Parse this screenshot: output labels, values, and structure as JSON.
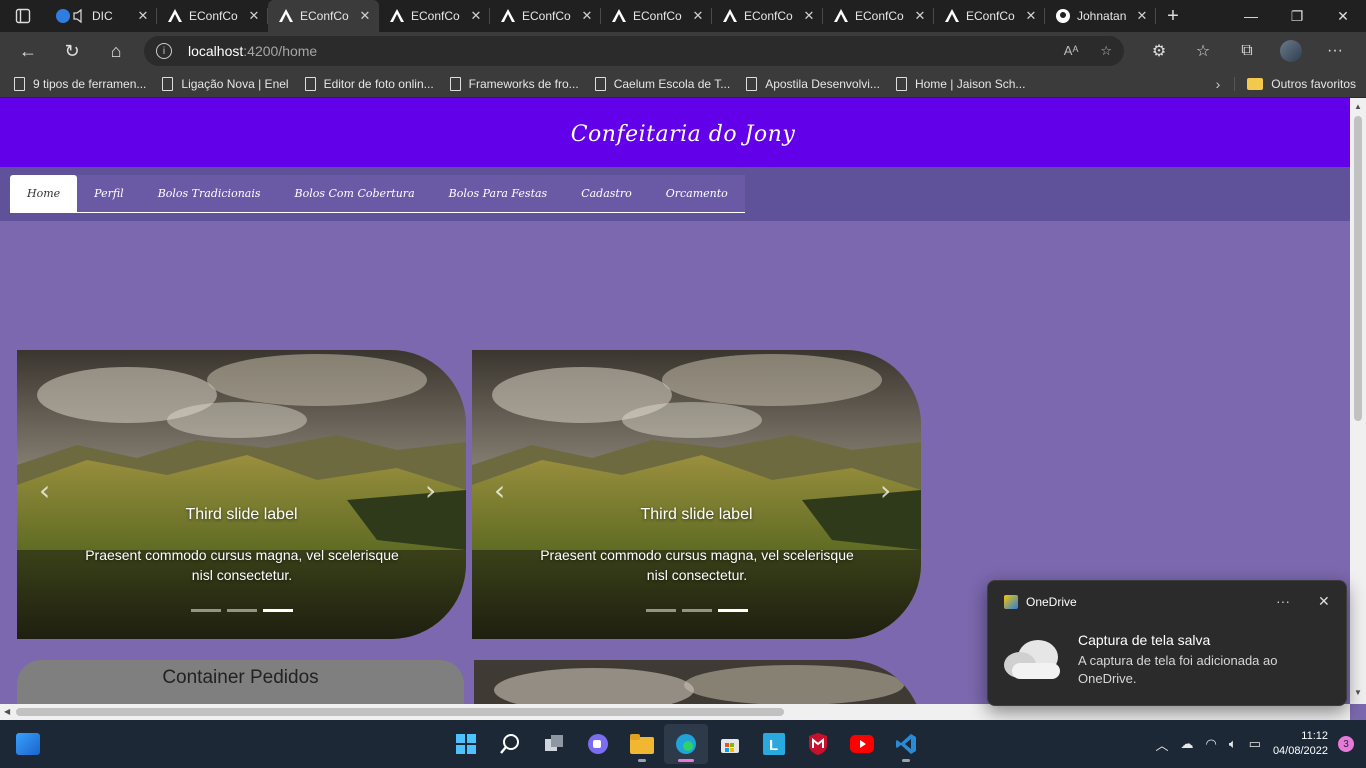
{
  "browser": {
    "tabs": [
      {
        "title": "DIC",
        "favicon": "speaker-icon",
        "active": false
      },
      {
        "title": "EConfCo",
        "favicon": "angular-icon",
        "active": false
      },
      {
        "title": "EConfCo",
        "favicon": "angular-icon",
        "active": true
      },
      {
        "title": "EConfCo",
        "favicon": "angular-icon",
        "active": false
      },
      {
        "title": "EConfCo",
        "favicon": "angular-icon",
        "active": false
      },
      {
        "title": "EConfCo",
        "favicon": "angular-icon",
        "active": false
      },
      {
        "title": "EConfCo",
        "favicon": "angular-icon",
        "active": false
      },
      {
        "title": "EConfCo",
        "favicon": "angular-icon",
        "active": false
      },
      {
        "title": "EConfCo",
        "favicon": "angular-icon",
        "active": false
      },
      {
        "title": "Johnatan",
        "favicon": "github-icon",
        "active": false
      }
    ],
    "address": {
      "host": "localhost",
      "path": ":4200/home"
    },
    "bookmarks": [
      "9 tipos de ferramen...",
      "Ligação Nova | Enel",
      "Editor de foto onlin...",
      "Frameworks de fro...",
      "Caelum Escola de T...",
      "Apostila Desenvolvi...",
      "Home | Jaison Sch..."
    ],
    "other_favorites": "Outros favoritos"
  },
  "site": {
    "title": "Confeitaria do Jony",
    "nav": [
      {
        "label": "Home",
        "active": true
      },
      {
        "label": "Perfil",
        "active": false
      },
      {
        "label": "Bolos Tradicionais",
        "active": false
      },
      {
        "label": "Bolos Com Cobertura",
        "active": false
      },
      {
        "label": "Bolos Para Festas",
        "active": false
      },
      {
        "label": "Cadastro",
        "active": false
      },
      {
        "label": "Orcamento",
        "active": false
      }
    ],
    "carousels": [
      {
        "title": "Third slide label",
        "text": "Praesent commodo cursus magna, vel scelerisque nisl consectetur.",
        "slides": 3,
        "active_slide": 3
      },
      {
        "title": "Third slide label",
        "text": "Praesent commodo cursus magna, vel scelerisque nisl consectetur.",
        "slides": 3,
        "active_slide": 3
      }
    ],
    "pedidos_title": "Container Pedidos"
  },
  "toast": {
    "app": "OneDrive",
    "title": "Captura de tela salva",
    "body": "A captura de tela foi adicionada ao OneDrive."
  },
  "taskbar": {
    "time": "11:12",
    "date": "04/08/2022",
    "notifications": "3",
    "apps": [
      "start-icon",
      "search-icon",
      "task-view-icon",
      "chat-icon",
      "file-explorer-icon",
      "edge-icon",
      "store-icon",
      "l-app-icon",
      "mcafee-icon",
      "youtube-icon",
      "vscode-icon"
    ]
  },
  "colors": {
    "header": "#6200ea",
    "page_bg": "#7b68ae",
    "nav_band": "#60529a"
  }
}
